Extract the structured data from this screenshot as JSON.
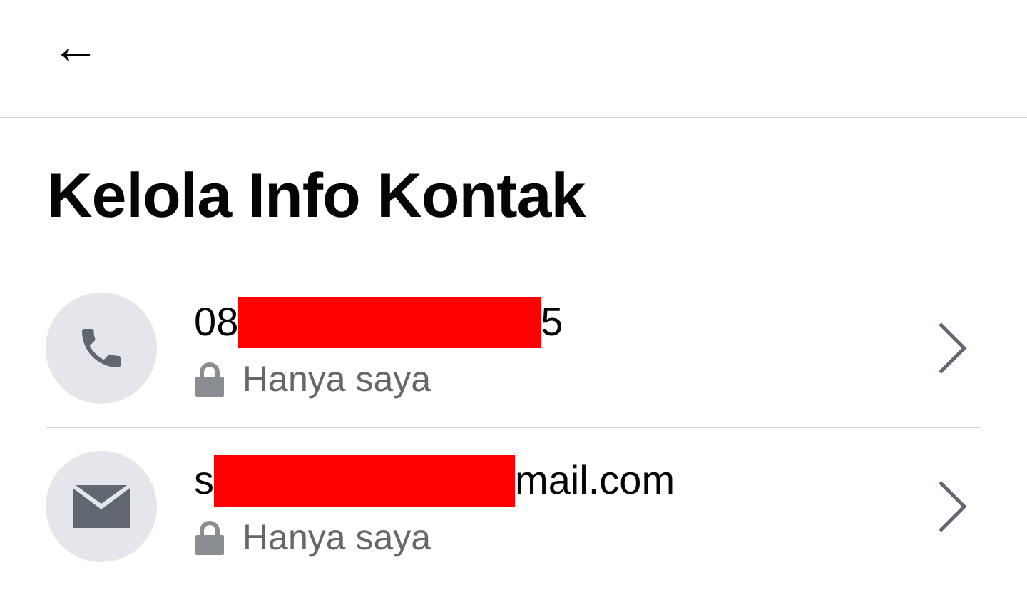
{
  "header": {
    "back": "←"
  },
  "title": "Kelola Info Kontak",
  "contacts": [
    {
      "kind": "phone",
      "value_before": "08",
      "value_after": "5",
      "privacy": "Hanya saya"
    },
    {
      "kind": "email",
      "value_before": "s",
      "value_after": "mail.com",
      "privacy": "Hanya saya"
    }
  ]
}
